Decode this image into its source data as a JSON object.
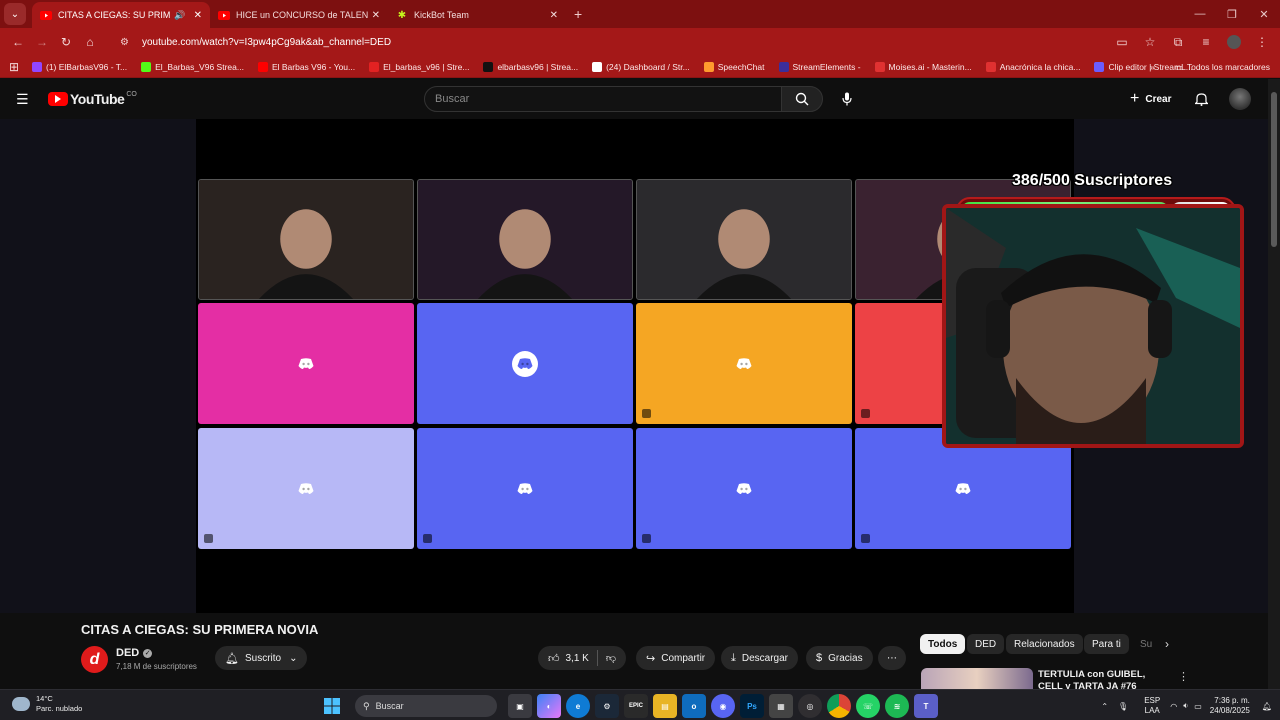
{
  "browser": {
    "tabs": [
      {
        "label": "CITAS A CIEGAS: SU PRIMERA",
        "active": true,
        "favicon": "youtube-icon",
        "audio": true
      },
      {
        "label": "HICE un CONCURSO de TALENTOS",
        "active": false,
        "favicon": "youtube-icon"
      },
      {
        "label": "KickBot Team",
        "active": false,
        "favicon": "kickbot-icon"
      }
    ],
    "url": "youtube.com/watch?v=I3pw4pCg9ak&ab_channel=DED",
    "bookmarks": [
      {
        "label": "(1) ElBarbasV96 - T...",
        "color": "#9146ff"
      },
      {
        "label": "El_Barbas_V96 Strea...",
        "color": "#53fc18"
      },
      {
        "label": "El Barbas V96 - You...",
        "color": "#ff0000"
      },
      {
        "label": "El_barbas_v96 | Stre...",
        "color": "#e22222"
      },
      {
        "label": "elbarbasv96 | Strea...",
        "color": "#111111"
      },
      {
        "label": "(24) Dashboard / Str...",
        "color": "#ffffff"
      },
      {
        "label": "SpeechChat",
        "color": "#ff9a2e"
      },
      {
        "label": "StreamElements -",
        "color": "#3b2e9b"
      },
      {
        "label": "Moises.ai - Masterin...",
        "color": "#e03131"
      },
      {
        "label": "Anacrónica la chica...",
        "color": "#e03131"
      },
      {
        "label": "Clip editor | StreamL...",
        "color": "#6b5cff"
      }
    ],
    "bookmarks_folder": "Todos los marcadores"
  },
  "youtube": {
    "logo_word": "YouTube",
    "logo_region": "CO",
    "search_placeholder": "Buscar",
    "create_label": "Crear"
  },
  "overlay": {
    "subs_goal_text": "386/500 Suscriptores",
    "subs_progress": 0.772
  },
  "video_tiles": [
    {
      "type": "camera",
      "color": "#2a2320"
    },
    {
      "type": "camera",
      "color": "#241828"
    },
    {
      "type": "camera",
      "color": "#2b2a2d"
    },
    {
      "type": "camera",
      "color": "#3a2230"
    },
    {
      "type": "discord",
      "color": "#e42ea4"
    },
    {
      "type": "discord",
      "color": "#5865f2",
      "speaking": true
    },
    {
      "type": "discord",
      "color": "#f5a623"
    },
    {
      "type": "discord",
      "color": "#ed4245"
    },
    {
      "type": "discord",
      "color": "#b7b8f6"
    },
    {
      "type": "discord",
      "color": "#5865f2"
    },
    {
      "type": "discord",
      "color": "#5865f2"
    },
    {
      "type": "discord",
      "color": "#5865f2"
    }
  ],
  "video": {
    "title": "CITAS A CIEGAS: SU PRIMERA NOVIA",
    "channel_initial": "d",
    "channel_name": "DED",
    "channel_subs": "7,18 M de suscriptores",
    "subscribed_label": "Suscrito",
    "likes": "3,1 K",
    "share_label": "Compartir",
    "download_label": "Descargar",
    "thanks_label": "Gracias"
  },
  "sidebar": {
    "chips": [
      "Todos",
      "DED",
      "Relacionados",
      "Para ti",
      "Su"
    ],
    "recommendation_title": "TERTULIA con GUIBEL, CELL y TARTA JA #76"
  },
  "taskbar": {
    "temp": "14°C",
    "weather": "Parc. nublado",
    "search_placeholder": "Buscar",
    "lang_line1": "ESP",
    "lang_line2": "LAA",
    "time": "7:36 p. m.",
    "date": "24/08/2025",
    "app_labels": {
      "epic": "EPIC",
      "ps": "Ps"
    }
  }
}
